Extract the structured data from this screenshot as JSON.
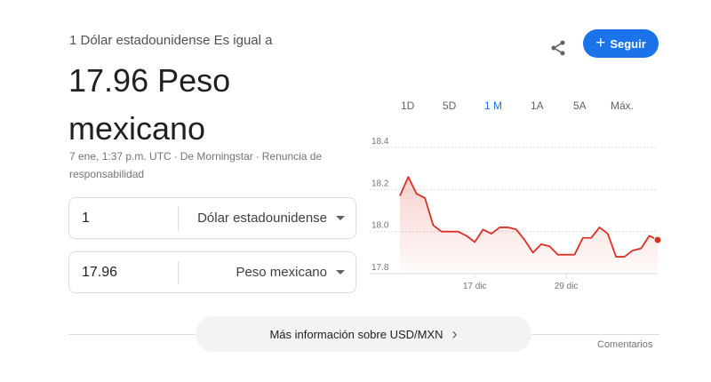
{
  "header": {
    "subtitle": "1 Dólar estadounidense Es igual a",
    "value_line1": "17.96 Peso",
    "value_line2": "mexicano",
    "meta_time": "7 ene, 1:37 p.m. UTC",
    "meta_sep1": "·",
    "meta_source": "De Morningstar",
    "meta_sep2": "·",
    "meta_disclaimer": "Renuncia de responsabilidad"
  },
  "actions": {
    "follow_label": "Seguir",
    "follow_icon": "+",
    "share_icon": "share-icon",
    "accent_color": "#1a73e8"
  },
  "converter": {
    "from": {
      "amount": "1",
      "currency": "Dólar estadounidense"
    },
    "to": {
      "amount": "17.96",
      "currency": "Peso mexicano"
    }
  },
  "ranges": {
    "items": [
      "1D",
      "5D",
      "1 M",
      "1A",
      "5A",
      "Máx."
    ],
    "active": "1 M"
  },
  "footer": {
    "more_label": "Más información sobre USD/MXN",
    "more_chevron": "›",
    "comments_label": "Comentarios"
  },
  "chart_data": {
    "type": "area",
    "title": "",
    "xlabel": "",
    "ylabel": "",
    "ylim": [
      17.8,
      18.4
    ],
    "yticks": [
      "18.4",
      "18.2",
      "18.0",
      "17.8"
    ],
    "xticks": [
      {
        "label": "17 dic",
        "index": 9
      },
      {
        "label": "29 dic",
        "index": 20
      }
    ],
    "line_color": "#d93025",
    "grid": true,
    "values": [
      18.17,
      18.26,
      18.18,
      18.16,
      18.03,
      18.0,
      18.0,
      18.0,
      17.98,
      17.95,
      18.01,
      17.99,
      18.02,
      18.02,
      18.01,
      17.96,
      17.9,
      17.94,
      17.93,
      17.89,
      17.89,
      17.89,
      17.97,
      17.97,
      18.02,
      17.99,
      17.88,
      17.88,
      17.91,
      17.92,
      17.98,
      17.96
    ]
  }
}
